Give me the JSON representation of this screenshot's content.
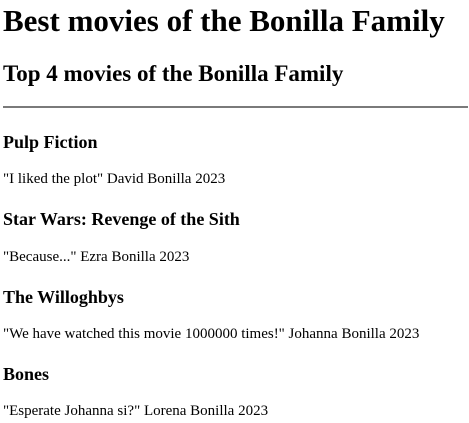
{
  "page": {
    "title": "Best movies of the Bonilla Family",
    "subtitle": "Top 4 movies of the Bonilla Family"
  },
  "movies": [
    {
      "title": "Pulp Fiction",
      "review": "\"I liked the plot\" David Bonilla 2023"
    },
    {
      "title": "Star Wars: Revenge of the Sith",
      "review": "\"Because...\" Ezra Bonilla 2023"
    },
    {
      "title": "The Willoghbys",
      "review": "\"We have watched this movie 1000000 times!\" Johanna Bonilla 2023"
    },
    {
      "title": "Bones",
      "review": "\"Esperate Johanna si?\" Lorena Bonilla 2023"
    }
  ]
}
